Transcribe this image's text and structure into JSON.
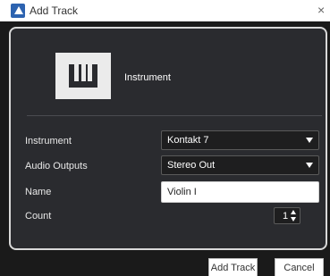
{
  "window": {
    "title": "Add Track",
    "close_glyph": "×",
    "app_icon": "app-icon"
  },
  "track_type": {
    "icon": "piano-icon",
    "label": "Instrument"
  },
  "fields": {
    "instrument": {
      "label": "Instrument",
      "value": "Kontakt 7"
    },
    "audio_outputs": {
      "label": "Audio Outputs",
      "value": "Stereo Out"
    },
    "name": {
      "label": "Name",
      "value": "Violin I"
    },
    "count": {
      "label": "Count",
      "value": "1"
    }
  },
  "buttons": {
    "add_track": "Add Track",
    "cancel": "Cancel"
  },
  "colors": {
    "panel_bg": "#2a2b2f",
    "window_bg": "#1a1a1a",
    "title_bar": "#ffffff"
  }
}
